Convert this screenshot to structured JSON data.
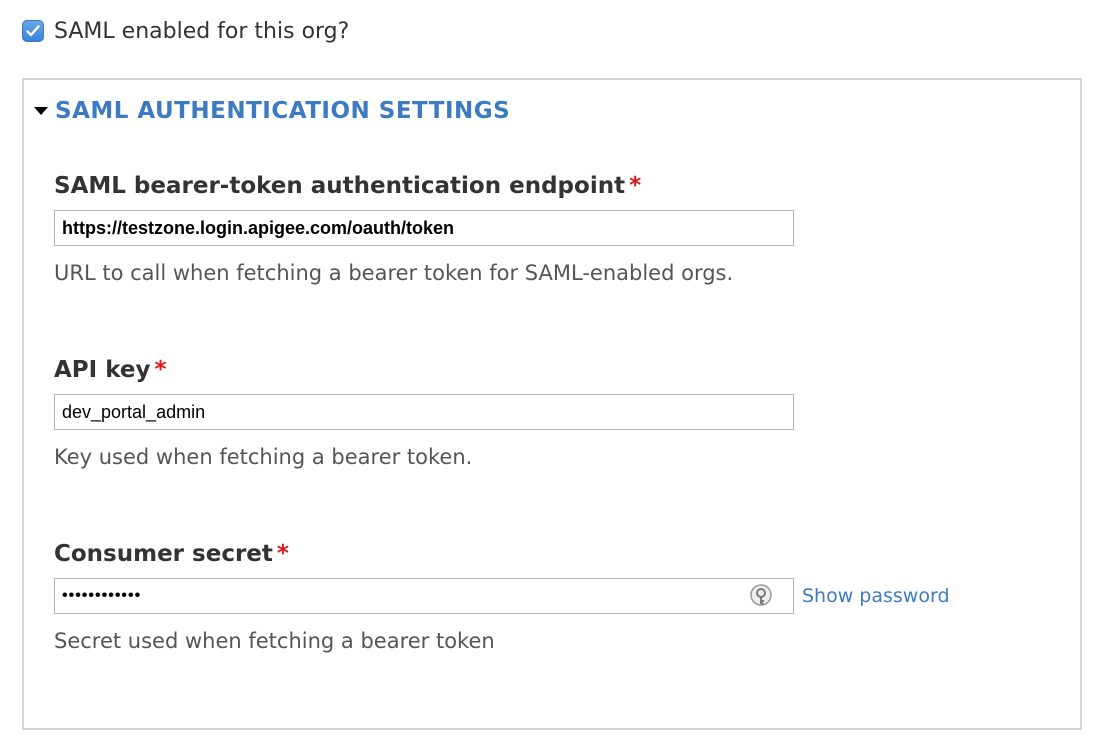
{
  "saml_toggle": {
    "label": "SAML enabled for this org?",
    "checked": true
  },
  "fieldset": {
    "legend": "SAML AUTHENTICATION SETTINGS"
  },
  "fields": {
    "endpoint": {
      "label": "SAML bearer-token authentication endpoint",
      "required_marker": "*",
      "value": "https://testzone.login.apigee.com/oauth/token",
      "description": "URL to call when fetching a bearer token for SAML-enabled orgs."
    },
    "api_key": {
      "label": "API key",
      "required_marker": "*",
      "value": "dev_portal_admin",
      "description": "Key used when fetching a bearer token."
    },
    "consumer_secret": {
      "label": "Consumer secret",
      "required_marker": "*",
      "value": "••••••••••••",
      "show_password_label": "Show password",
      "description": "Secret used when fetching a bearer token"
    }
  },
  "icons": {
    "checkbox": "checkmark-icon",
    "legend_toggle": "caret-down-icon",
    "password_manager": "key-icon"
  },
  "colors": {
    "accent_blue": "#3c7ac2",
    "checkbox_blue": "#3b82d9",
    "required_red": "#e0161b",
    "border_gray": "#d4d4d4"
  }
}
